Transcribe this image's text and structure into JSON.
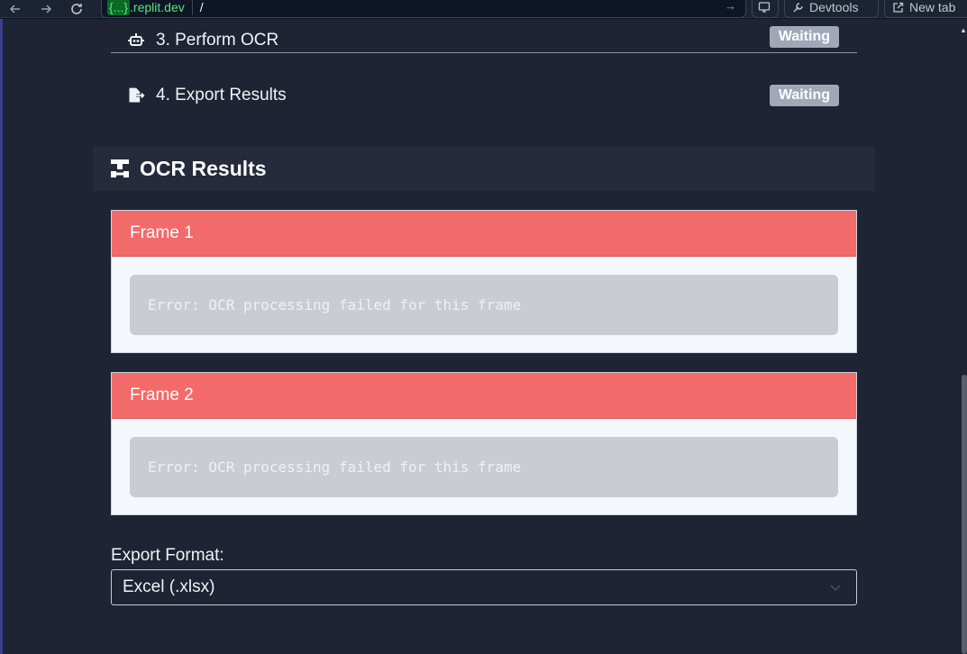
{
  "browser": {
    "url_badge": "{...}",
    "url_host": ".replit.dev",
    "url_path": "/",
    "devtools_label": "Devtools",
    "newtab_label": "New tab"
  },
  "steps": [
    {
      "label": "3. Perform OCR",
      "status": "Waiting"
    },
    {
      "label": "4. Export Results",
      "status": "Waiting"
    }
  ],
  "results": {
    "title": "OCR Results",
    "frames": [
      {
        "title": "Frame 1",
        "message": "Error: OCR processing failed for this frame"
      },
      {
        "title": "Frame 2",
        "message": "Error: OCR processing failed for this frame"
      }
    ]
  },
  "export": {
    "label": "Export Format:",
    "selected": "Excel (.xlsx)"
  },
  "colors": {
    "frame_header": "#f36a6a",
    "badge": "#a0a8b8",
    "background": "#1e2433"
  }
}
